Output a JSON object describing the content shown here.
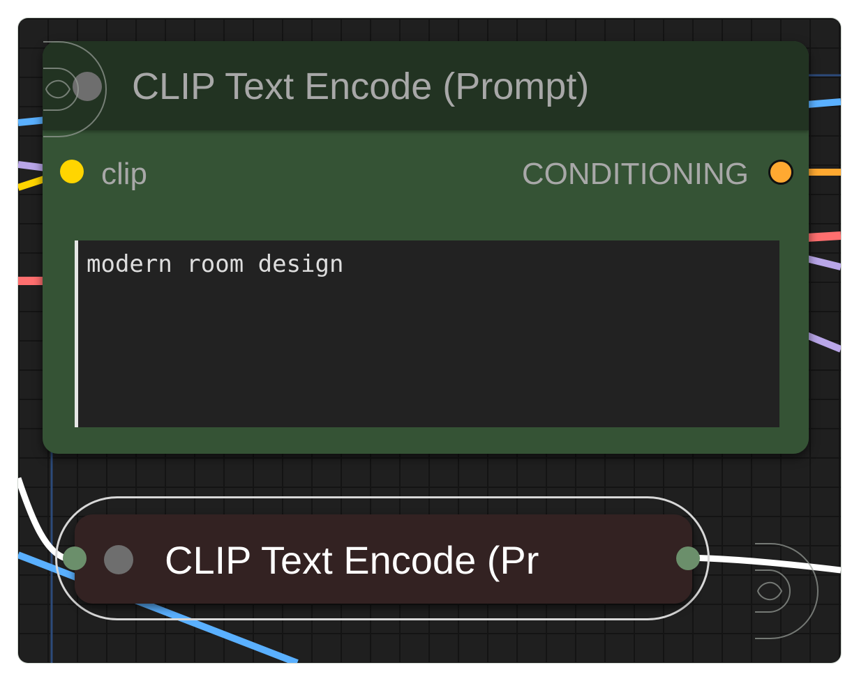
{
  "node_main": {
    "title": "CLIP Text Encode (Prompt)",
    "input_label": "clip",
    "output_label": "CONDITIONING",
    "prompt_text": "modern room design"
  },
  "node_collapsed": {
    "title": "CLIP Text Encode (Pr"
  },
  "colors": {
    "clip_slot": "#ffd500",
    "conditioning_slot": "#ffa931",
    "node_body": "#355335",
    "node_header": "#223322",
    "collapsed_node": "#332222"
  }
}
